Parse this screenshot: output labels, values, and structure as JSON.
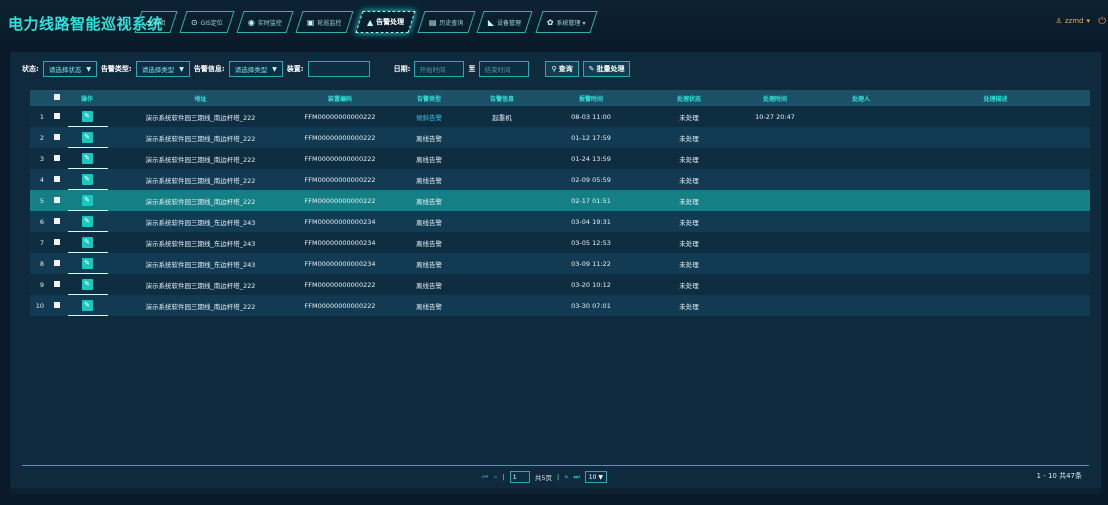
{
  "app": {
    "title": "电力线路智能巡视系统"
  },
  "nav": [
    {
      "icon": "home-icon",
      "glyph": "⌂",
      "label": "首页"
    },
    {
      "icon": "location-icon",
      "glyph": "⊙",
      "label": "GIS定位"
    },
    {
      "icon": "monitor-icon",
      "glyph": "◉",
      "label": "实时监控"
    },
    {
      "icon": "camera-icon",
      "glyph": "▣",
      "label": "轮巡监控"
    },
    {
      "icon": "warning-icon",
      "glyph": "▲",
      "label": "告警处理",
      "active": true
    },
    {
      "icon": "history-icon",
      "glyph": "▤",
      "label": "历史查询"
    },
    {
      "icon": "device-icon",
      "glyph": "◣",
      "label": "设备管理"
    },
    {
      "icon": "gear-icon",
      "glyph": "✿",
      "label": "系统管理 ▾"
    }
  ],
  "user": {
    "name": "zzmd",
    "caret": "▾"
  },
  "filters": {
    "status_label": "状态:",
    "status_value": "请选择状态",
    "alarm_type_label": "告警类型:",
    "alarm_type_value": "请选择类型",
    "alarm_info_label": "告警信息:",
    "alarm_info_value": "请选择类型",
    "device_label": "装置:",
    "date_label": "日期:",
    "start_placeholder": "开始时间",
    "to_label": "至",
    "end_placeholder": "结束时间",
    "query_button": "查询",
    "batch_button": "批量处理"
  },
  "table": {
    "headers": [
      "操作",
      "地址",
      "装置编码",
      "告警类型",
      "告警信息",
      "报警时间",
      "处理状态",
      "处理时间",
      "处理人",
      "处理描述"
    ],
    "rows": [
      {
        "idx": "1",
        "addr": "演示系统软件园三期线_南边杆塔_222",
        "code": "FFM00000000000222",
        "type": "倾斜告警",
        "info": "起重机",
        "time": "08-03 11:00",
        "state": "未处理",
        "ptime": "10-27 20:47",
        "person": "",
        "desc": ""
      },
      {
        "idx": "2",
        "addr": "演示系统软件园三期线_南边杆塔_222",
        "code": "FFM00000000000222",
        "type": "离线告警",
        "info": "",
        "time": "01-12 17:59",
        "state": "未处理",
        "ptime": "",
        "person": "",
        "desc": ""
      },
      {
        "idx": "3",
        "addr": "演示系统软件园三期线_南边杆塔_222",
        "code": "FFM00000000000222",
        "type": "离线告警",
        "info": "",
        "time": "01-24 13:59",
        "state": "未处理",
        "ptime": "",
        "person": "",
        "desc": ""
      },
      {
        "idx": "4",
        "addr": "演示系统软件园三期线_南边杆塔_222",
        "code": "FFM00000000000222",
        "type": "离线告警",
        "info": "",
        "time": "02-09 05:59",
        "state": "未处理",
        "ptime": "",
        "person": "",
        "desc": ""
      },
      {
        "idx": "5",
        "addr": "演示系统软件园三期线_南边杆塔_222",
        "code": "FFM00000000000222",
        "type": "离线告警",
        "info": "",
        "time": "02-17 01:51",
        "state": "未处理",
        "ptime": "",
        "person": "",
        "desc": ""
      },
      {
        "idx": "6",
        "addr": "演示系统软件园三期线_东边杆塔_243",
        "code": "FFM00000000000234",
        "type": "离线告警",
        "info": "",
        "time": "03-04 19:31",
        "state": "未处理",
        "ptime": "",
        "person": "",
        "desc": ""
      },
      {
        "idx": "7",
        "addr": "演示系统软件园三期线_东边杆塔_243",
        "code": "FFM00000000000234",
        "type": "离线告警",
        "info": "",
        "time": "03-05 12:53",
        "state": "未处理",
        "ptime": "",
        "person": "",
        "desc": ""
      },
      {
        "idx": "8",
        "addr": "演示系统软件园三期线_东边杆塔_243",
        "code": "FFM00000000000234",
        "type": "离线告警",
        "info": "",
        "time": "03-09 11:22",
        "state": "未处理",
        "ptime": "",
        "person": "",
        "desc": ""
      },
      {
        "idx": "9",
        "addr": "演示系统软件园三期线_南边杆塔_222",
        "code": "FFM00000000000222",
        "type": "离线告警",
        "info": "",
        "time": "03-20 10:12",
        "state": "未处理",
        "ptime": "",
        "person": "",
        "desc": ""
      },
      {
        "idx": "10",
        "addr": "演示系统软件园三期线_南边杆塔_222",
        "code": "FFM00000000000222",
        "type": "离线告警",
        "info": "",
        "time": "03-30 07:01",
        "state": "未处理",
        "ptime": "",
        "person": "",
        "desc": ""
      }
    ],
    "selected_row": 5
  },
  "pager": {
    "current_page": "1",
    "total_pages_text": "共5页",
    "page_size": "10",
    "range_text": "1 - 10 共47条"
  },
  "colors": {
    "accent": "#2de3d9",
    "link": "#39c2ea",
    "selected_row": "#157f86",
    "user": "#e9a95b"
  }
}
